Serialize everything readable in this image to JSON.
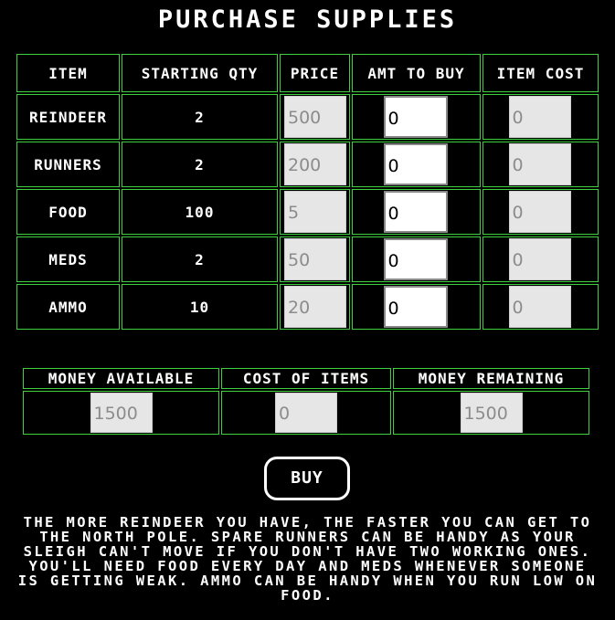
{
  "title": "PURCHASE SUPPLIES",
  "table": {
    "headers": {
      "item": "ITEM",
      "starting_qty": "STARTING QTY",
      "price": "PRICE",
      "amt_to_buy": "AMT TO BUY",
      "item_cost": "ITEM COST"
    },
    "rows": [
      {
        "item": "REINDEER",
        "starting_qty": "2",
        "price": "500",
        "amt_to_buy": "0",
        "item_cost": "0"
      },
      {
        "item": "RUNNERS",
        "starting_qty": "2",
        "price": "200",
        "amt_to_buy": "0",
        "item_cost": "0"
      },
      {
        "item": "FOOD",
        "starting_qty": "100",
        "price": "5",
        "amt_to_buy": "0",
        "item_cost": "0"
      },
      {
        "item": "MEDS",
        "starting_qty": "2",
        "price": "50",
        "amt_to_buy": "0",
        "item_cost": "0"
      },
      {
        "item": "AMMO",
        "starting_qty": "10",
        "price": "20",
        "amt_to_buy": "0",
        "item_cost": "0"
      }
    ]
  },
  "summary": {
    "money_available_label": "MONEY AVAILABLE",
    "cost_of_items_label": "COST OF ITEMS",
    "money_remaining_label": "MONEY REMAINING",
    "money_available": "1500",
    "cost_of_items": "0",
    "money_remaining": "1500"
  },
  "buy_label": "BUY",
  "info_text": "THE MORE REINDEER YOU HAVE, THE FASTER YOU CAN GET TO THE NORTH POLE. SPARE RUNNERS CAN BE HANDY AS YOUR SLEIGH CAN'T MOVE IF YOU DON'T HAVE TWO WORKING ONES. YOU'LL NEED FOOD EVERY DAY AND MEDS WHENEVER SOMEONE IS GETTING WEAK. AMMO CAN BE HANDY WHEN YOU RUN LOW ON FOOD.",
  "colors": {
    "background": "#000000",
    "grid_border": "#3fcf3f",
    "text": "#ffffff",
    "readonly_field": "#e6e6e6"
  }
}
